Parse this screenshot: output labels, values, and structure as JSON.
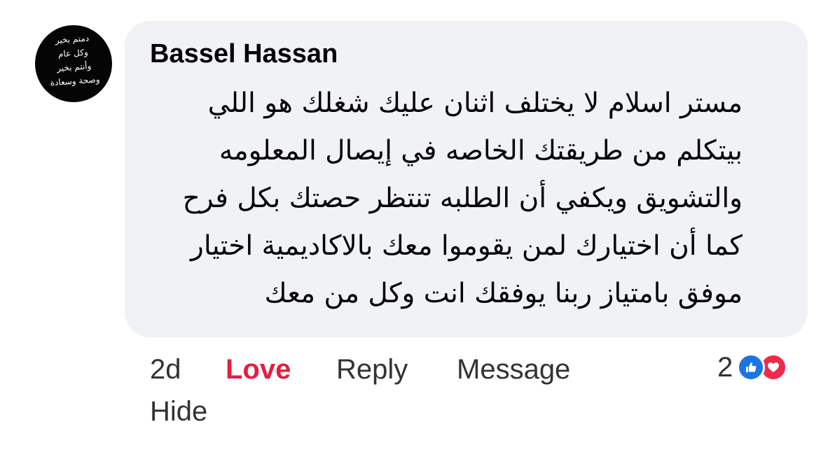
{
  "comment": {
    "author": "Bassel Hassan",
    "avatar_text": "دمتم بخير\nوكل عام\nوأنتم بخير\nوصحة وسعادة",
    "lines": [
      "مستر اسلام لا يختلف اثنان عليك شغلك هو اللي",
      "بيتكلم من طريقتك الخاصه في إيصال المعلومه",
      "والتشويق ويكفي أن الطلبه تنتظر حصتك بكل فرح",
      "كما أن اختيارك لمن يقوموا معك بالاكاديمية اختيار",
      "موفق بامتياز ربنا يوفقك انت وكل من معك"
    ]
  },
  "actions": {
    "time": "2d",
    "love_label": "Love",
    "reply_label": "Reply",
    "message_label": "Message",
    "hide_label": "Hide"
  },
  "reactions": {
    "count": "2",
    "icons": [
      "like-icon",
      "love-icon"
    ]
  },
  "colors": {
    "bubble_bg": "#f0f2f5",
    "love_red": "#e41e3f",
    "like_blue": "#1b74e4",
    "heart_red": "#f02849"
  }
}
